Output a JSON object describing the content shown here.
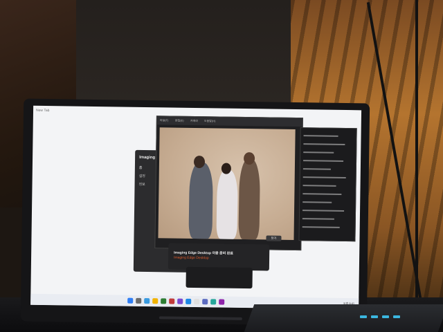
{
  "browser": {
    "tab_title": "New Tab"
  },
  "imaging_app": {
    "title": "Imaging Edge",
    "nav": [
      "홈",
      "설정",
      "정보"
    ]
  },
  "viewer": {
    "menu": [
      "파일(F)",
      "편집(E)",
      "카메라",
      "도움말(H)"
    ],
    "close_label": "닫기"
  },
  "notification": {
    "title": "Imaging Edge Desktop 이용 준비 완료",
    "subtitle": "Imaging Edge Desktop"
  },
  "taskbar": {
    "clock": "오후 9:41"
  }
}
